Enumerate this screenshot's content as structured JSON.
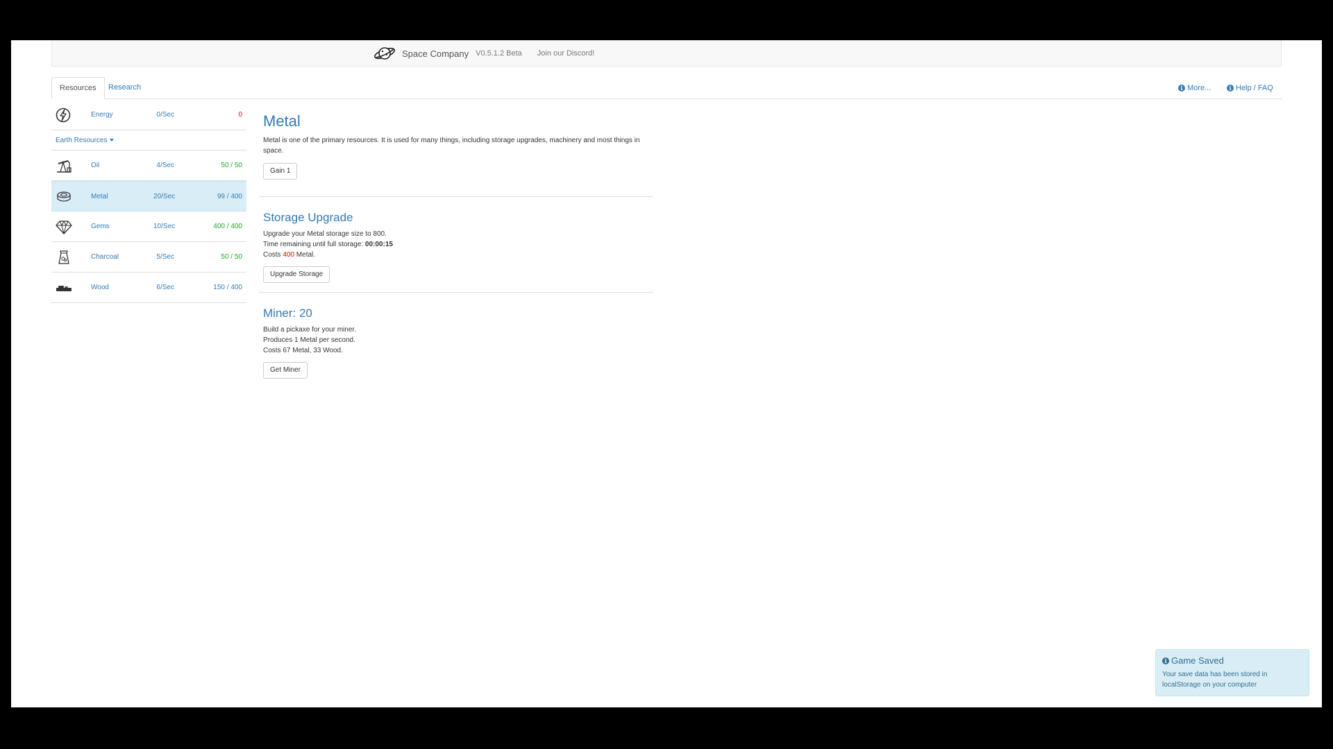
{
  "navbar": {
    "brand": "Space Company",
    "version": "V0.5.1.2 Beta",
    "discord": "Join our Discord!"
  },
  "tabs": [
    {
      "label": "Resources",
      "active": true
    },
    {
      "label": "Research",
      "active": false
    }
  ],
  "tabs_right": [
    {
      "label": "More..."
    },
    {
      "label": "Help / FAQ"
    }
  ],
  "energy": {
    "name": "Energy",
    "rate": "0/Sec",
    "amount": "0",
    "icon": "lightning-icon"
  },
  "group": {
    "label": "Earth Resources"
  },
  "resources": [
    {
      "name": "Oil",
      "rate": "4/Sec",
      "current": "50",
      "max": "50",
      "full": true,
      "icon": "oil-pump-icon"
    },
    {
      "name": "Metal",
      "rate": "20/Sec",
      "current": "99",
      "max": "400",
      "full": false,
      "icon": "metal-icon"
    },
    {
      "name": "Gems",
      "rate": "10/Sec",
      "current": "400",
      "max": "400",
      "full": true,
      "icon": "gem-icon"
    },
    {
      "name": "Charcoal",
      "rate": "5/Sec",
      "current": "50",
      "max": "50",
      "full": true,
      "icon": "charcoal-bag-icon"
    },
    {
      "name": "Wood",
      "rate": "6/Sec",
      "current": "150",
      "max": "400",
      "full": false,
      "icon": "wood-log-icon"
    }
  ],
  "main": {
    "title": "Metal",
    "description": "Metal is one of the primary resources. It is used for many things, including storage upgrades, machinery and most things in space.",
    "gain_label": "Gain 1",
    "storage": {
      "title": "Storage Upgrade",
      "line1": "Upgrade your Metal storage size to 800.",
      "time_label": "Time remaining until full storage: ",
      "time_value": "00:00:15",
      "cost_prefix": "Costs ",
      "cost_value": "400",
      "cost_suffix": " Metal.",
      "button": "Upgrade Storage"
    },
    "miner": {
      "title": "Miner: 20",
      "line1": "Build a pickaxe for your miner.",
      "line2": "Produces 1 Metal per second.",
      "line3": "Costs 67 Metal, 33 Wood.",
      "button": "Get Miner"
    }
  },
  "notification": {
    "title": "Game Saved",
    "message": "Your save data has been stored in localStorage on your computer"
  },
  "colors": {
    "link": "#337ab7",
    "full": "#22aa22",
    "warning": "#ee0000",
    "selected_bg": "#d9edf7"
  }
}
